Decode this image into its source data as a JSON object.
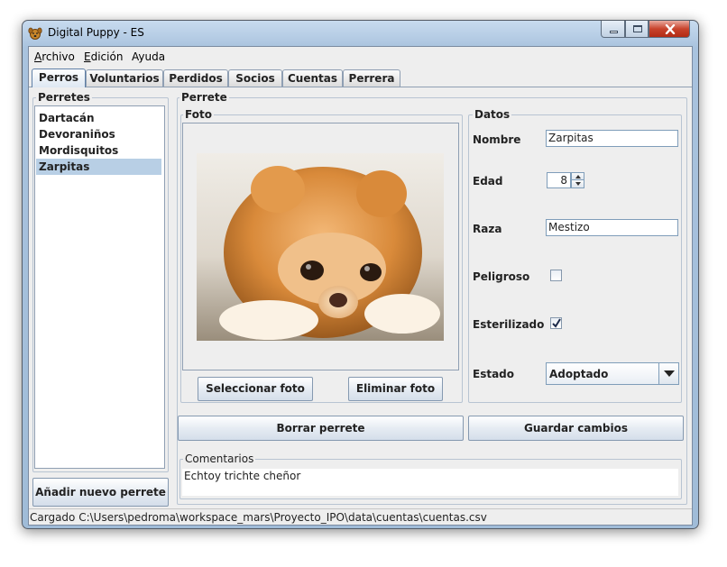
{
  "window": {
    "title": "Digital Puppy - ES"
  },
  "menu": [
    {
      "label": "Archivo",
      "mnemonic": "A",
      "rest": "rchivo"
    },
    {
      "label": "Edición",
      "mnemonic": "E",
      "rest": "dición"
    },
    {
      "label": "Ayuda"
    }
  ],
  "tabs": [
    {
      "label": "Perros",
      "selected": true
    },
    {
      "label": "Voluntarios"
    },
    {
      "label": "Perdidos"
    },
    {
      "label": "Socios"
    },
    {
      "label": "Cuentas"
    },
    {
      "label": "Perrera"
    }
  ],
  "perretes": {
    "title": "Perretes",
    "items": [
      "Dartacán",
      "Devoraniños",
      "Mordisquitos",
      "Zarpitas"
    ],
    "selected": "Zarpitas",
    "add_button": "Añadir nuevo perrete"
  },
  "perrete": {
    "title": "Perrete",
    "foto": {
      "title": "Foto",
      "select_button": "Seleccionar foto",
      "delete_button": "Eliminar foto"
    },
    "datos": {
      "title": "Datos",
      "nombre_label": "Nombre",
      "nombre_value": "Zarpitas",
      "edad_label": "Edad",
      "edad_value": "8",
      "raza_label": "Raza",
      "raza_value": "Mestizo",
      "peligroso_label": "Peligroso",
      "peligroso_checked": false,
      "esterilizado_label": "Esterilizado",
      "esterilizado_checked": true,
      "estado_label": "Estado",
      "estado_value": "Adoptado"
    },
    "delete_button": "Borrar perrete",
    "save_button": "Guardar cambios",
    "comentarios": {
      "title": "Comentarios",
      "text": "Echtoy trichte cheñor"
    }
  },
  "status": "Cargado C:\\Users\\pedroma\\workspace_mars\\Proyecto_IPO\\data\\cuentas\\cuentas.csv",
  "colors": {
    "selection": "#b8cfe5",
    "close_button": "#c8432c",
    "window_frame": "#a9c3de"
  }
}
